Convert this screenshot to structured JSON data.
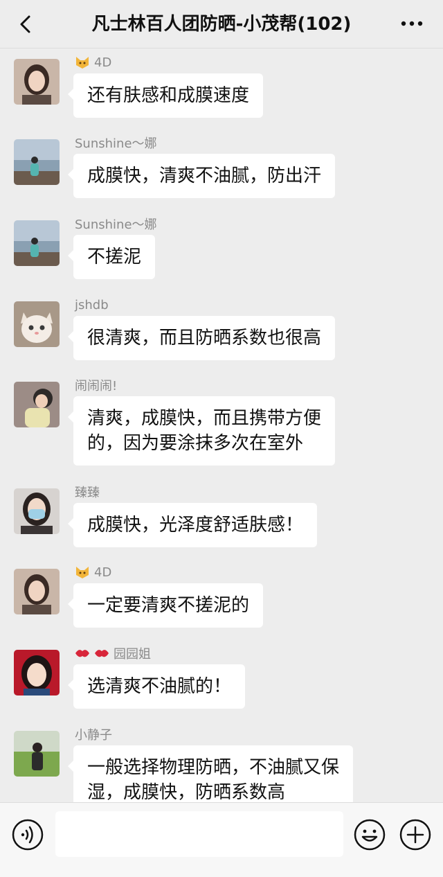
{
  "header": {
    "title": "凡士林百人团防晒-小茂帮(102)",
    "back_icon": "chevron-left-icon",
    "more_icon": "more-dots-icon"
  },
  "messages": [
    {
      "sender": "4D",
      "sender_prefix_icons": [
        "cat-face-icon"
      ],
      "avatar": "woman-portrait-avatar",
      "text": "还有肤感和成膜速度"
    },
    {
      "sender": "Sunshine～娜",
      "sender_prefix_icons": [],
      "avatar": "beach-avatar",
      "text": "成膜快，清爽不油腻，防出汗"
    },
    {
      "sender": "Sunshine～娜",
      "sender_prefix_icons": [],
      "avatar": "beach-avatar",
      "text": "不搓泥"
    },
    {
      "sender": "jshdb",
      "sender_prefix_icons": [],
      "avatar": "kitten-avatar",
      "text": "很清爽，而且防晒系数也很高"
    },
    {
      "sender": "闹闹闹!",
      "sender_prefix_icons": [],
      "avatar": "child-avatar",
      "text": "清爽，成膜快，而且携带方便\n的，因为要涂抹多次在室外"
    },
    {
      "sender": "臻臻",
      "sender_prefix_icons": [],
      "avatar": "masked-woman-avatar",
      "text": "成膜快，光泽度舒适肤感！"
    },
    {
      "sender": "4D",
      "sender_prefix_icons": [
        "cat-face-icon"
      ],
      "avatar": "woman-portrait-avatar",
      "text": "一定要清爽不搓泥的"
    },
    {
      "sender": "园园姐",
      "sender_prefix_icons": [
        "lips-icon",
        "lips-icon"
      ],
      "avatar": "cartoon-girl-avatar",
      "text": "选清爽不油腻的！"
    },
    {
      "sender": "小静子",
      "sender_prefix_icons": [],
      "avatar": "outdoor-woman-avatar",
      "text": "一般选择物理防晒，不油腻又保\n湿，成膜快，防晒系数高"
    }
  ],
  "footer": {
    "input_value": "",
    "voice_icon": "voice-icon",
    "emoji_icon": "smiley-icon",
    "add_icon": "plus-circle-icon"
  },
  "colors": {
    "background": "#ededed",
    "bubble": "#ffffff",
    "sender_name": "#8a8a8a",
    "text": "#111111"
  }
}
